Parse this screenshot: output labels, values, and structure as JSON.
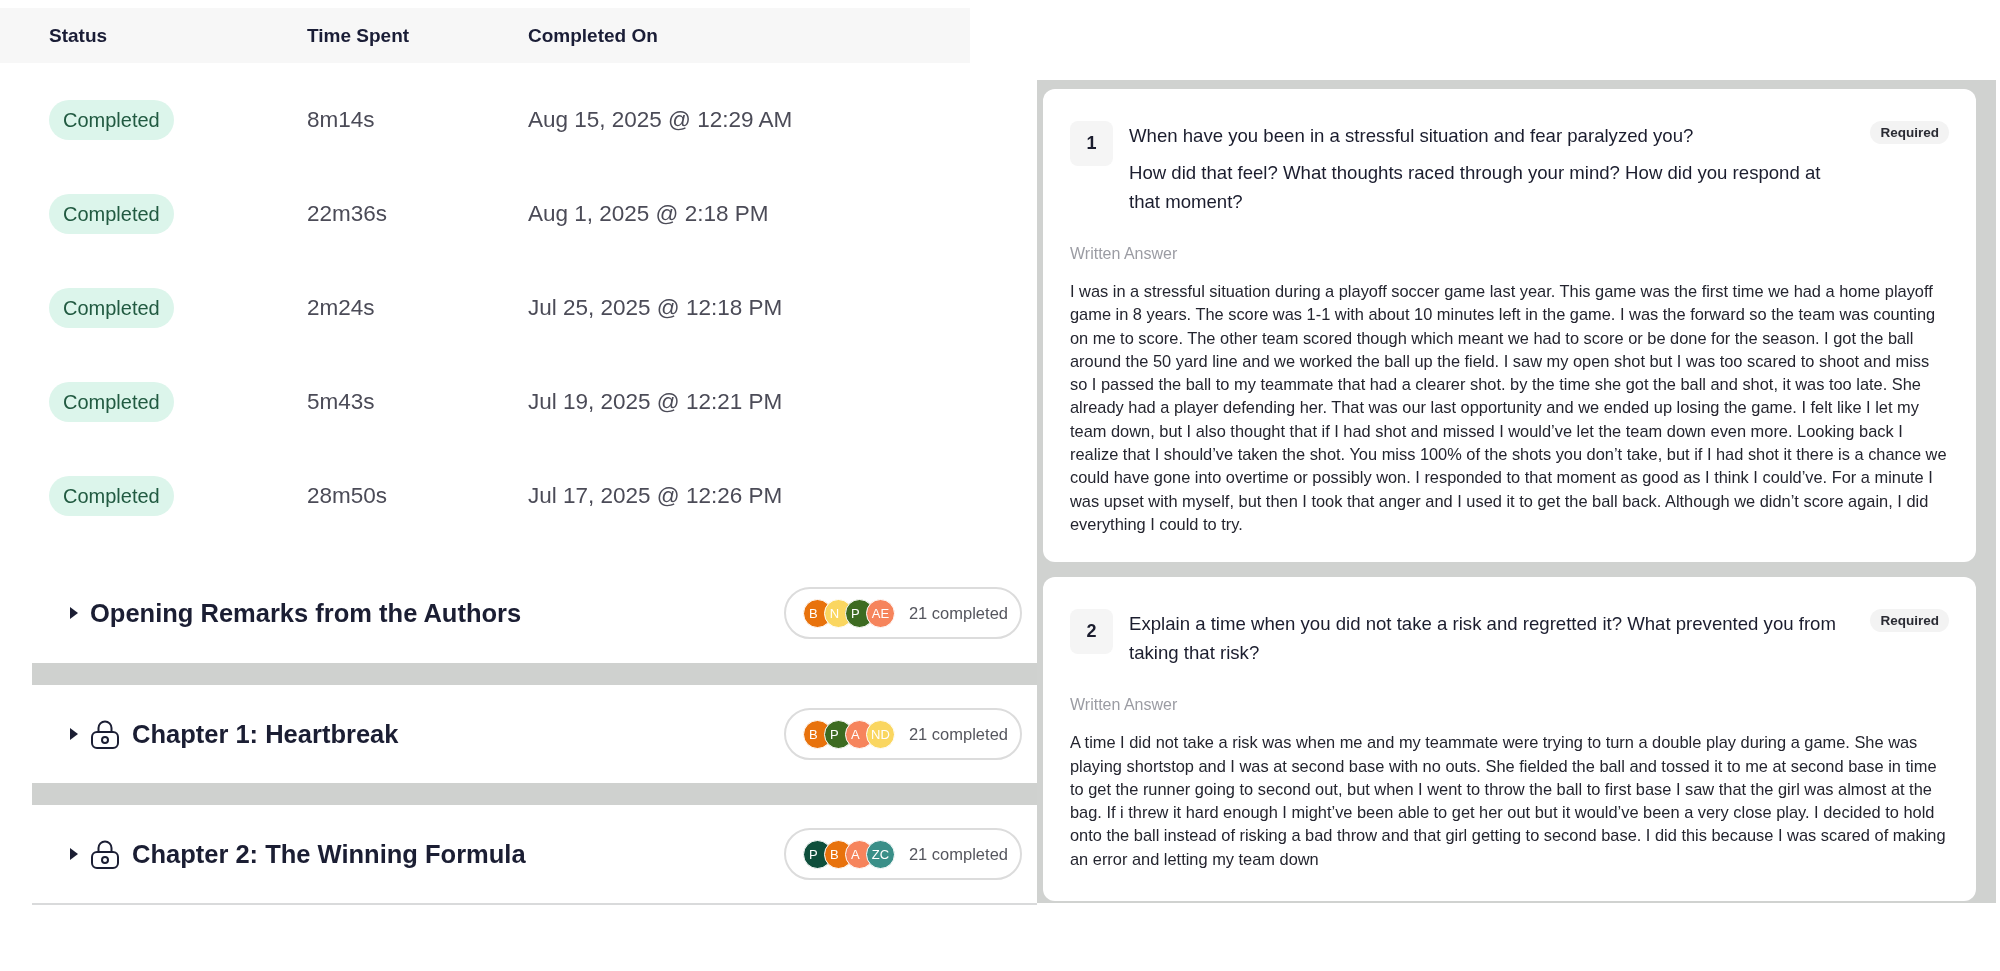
{
  "table": {
    "columns": [
      "Status",
      "Time Spent",
      "Completed On"
    ],
    "rows": [
      {
        "status": "Completed",
        "time_spent": "8m14s",
        "completed_on": "Aug 15, 2025 @ 12:29 AM"
      },
      {
        "status": "Completed",
        "time_spent": "22m36s",
        "completed_on": "Aug 1, 2025 @ 2:18 PM"
      },
      {
        "status": "Completed",
        "time_spent": "2m24s",
        "completed_on": "Jul 25, 2025 @ 12:18 PM"
      },
      {
        "status": "Completed",
        "time_spent": "5m43s",
        "completed_on": "Jul 19, 2025 @ 12:21 PM"
      },
      {
        "status": "Completed",
        "time_spent": "28m50s",
        "completed_on": "Jul 17, 2025 @ 12:26 PM"
      }
    ]
  },
  "sections": [
    {
      "title": "Opening Remarks from the Authors",
      "expanded": false,
      "locked": false,
      "avatars": [
        {
          "initials": "B",
          "color": "#e8720c"
        },
        {
          "initials": "N",
          "color": "#fad660"
        },
        {
          "initials": "P",
          "color": "#3d6b21"
        },
        {
          "initials": "AE",
          "color": "#f6845c"
        }
      ],
      "completed": "21 completed"
    },
    {
      "title": "Chapter 1: Heartbreak",
      "expanded": false,
      "locked": true,
      "avatars": [
        {
          "initials": "B",
          "color": "#e8720c"
        },
        {
          "initials": "P",
          "color": "#3d6b21"
        },
        {
          "initials": "A",
          "color": "#f6845c"
        },
        {
          "initials": "ND",
          "color": "#fad660"
        }
      ],
      "completed": "21 completed"
    },
    {
      "title": "Chapter 2: The Winning Formula",
      "expanded": false,
      "locked": true,
      "avatars": [
        {
          "initials": "P",
          "color": "#0f4f3c"
        },
        {
          "initials": "B",
          "color": "#e8720c"
        },
        {
          "initials": "A",
          "color": "#f6845c"
        },
        {
          "initials": "ZC",
          "color": "#3a8f88"
        }
      ],
      "completed": "21 completed"
    }
  ],
  "questions": [
    {
      "number": "1",
      "required": "Required",
      "prompt": [
        "When have you been in a stressful situation and fear paralyzed you?",
        "How did that feel? What thoughts raced through your mind? How did you respond at that moment?"
      ],
      "answer_label": "Written Answer",
      "answer": "I was in a stressful situation during a playoff soccer game last year. This game was the first time we had a home playoff game in 8 years. The score was 1-1 with about 10 minutes left in the game. I was the forward so the team was counting on me to score. The other team scored though which meant we had to score or be done for the season. I got the ball around the 50 yard line and we worked the ball up the field. I saw my open shot but I was too scared to shoot and miss so I passed the ball to my teammate that had a clearer shot. by the time she got the ball and shot, it was too late. She already had a player defending her. That was our last opportunity and we ended up losing the game. I felt like I let my team down, but I also thought that if I had shot and missed I would’ve let the team down even more. Looking back I realize that I should’ve taken the shot. You miss 100% of the shots you don’t take, but if I had shot it there is a chance we could have gone into overtime or possibly won. I responded to that moment as good as I think I could’ve. For a minute I was upset with myself, but then I took that anger and I used it to get the ball back. Although we didn’t score again, I did everything I could to try."
    },
    {
      "number": "2",
      "required": "Required",
      "prompt": [
        "Explain a time when you did not take a risk and regretted it? What prevented you from taking that risk?"
      ],
      "answer_label": "Written Answer",
      "answer": "A time I did not take a risk was when me and my teammate were trying to turn a double play during a game. She was playing shortstop and I was at second base with no outs. She fielded the ball and tossed it to me at second base in time to get the runner going to second out, but when I went to throw the ball to first base I saw that the girl was almost at the bag. If i threw it hard enough I might’ve been able to get her out but it would’ve been a very close play. I decided to hold onto the ball instead of risking a bad throw and that girl getting to second base. I did this because I was scared of making an error and letting my team down"
    }
  ]
}
